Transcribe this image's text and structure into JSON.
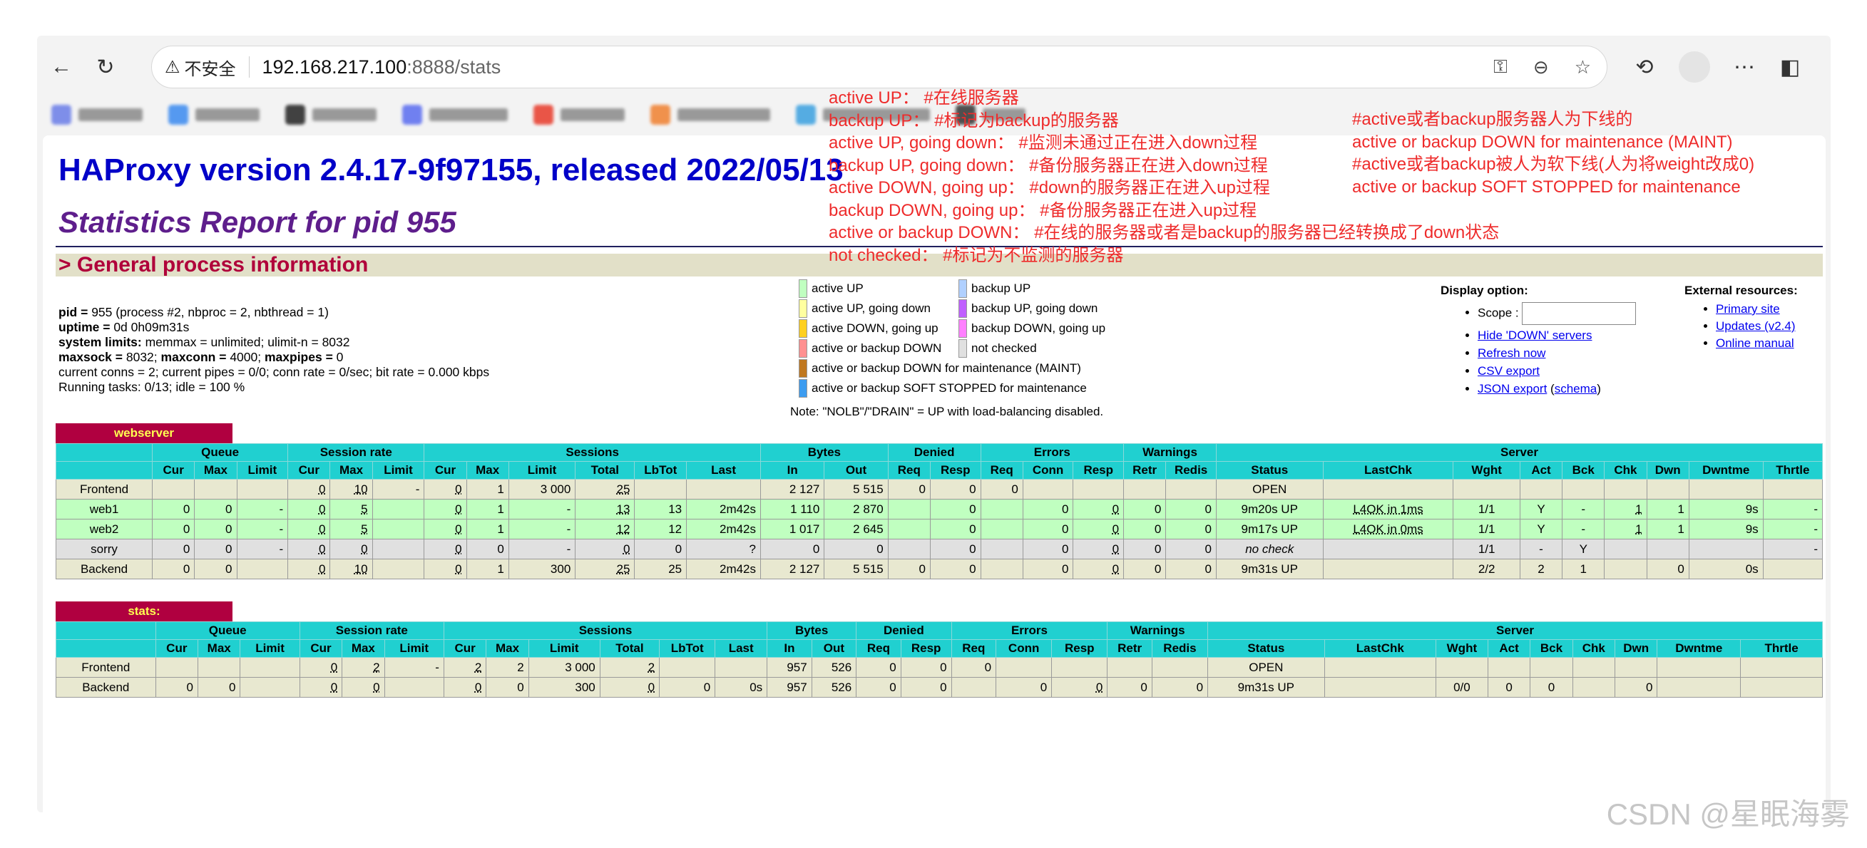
{
  "browser": {
    "security_label": "不安全",
    "url_host": "192.168.217.100",
    "url_path": ":8888/stats"
  },
  "page": {
    "title": "HAProxy version 2.4.17-9f97155, released 2022/05/13",
    "subtitle": "Statistics Report for pid 955",
    "section": "> General process information"
  },
  "process": {
    "pid_label": "pid =",
    "pid_value": " 955 (process #2, nbproc = 2, nbthread = 1)",
    "uptime_label": "uptime =",
    "uptime_value": " 0d 0h09m31s",
    "limits_label": "system limits:",
    "limits_value": " memmax = unlimited; ulimit-n = 8032",
    "maxsock_label": "maxsock =",
    "maxsock_value": " 8032; ",
    "maxconn_label": "maxconn =",
    "maxconn_value": " 4000; ",
    "maxpipes_label": "maxpipes =",
    "maxpipes_value": " 0",
    "conns": "current conns = 2; current pipes = 0/0; conn rate = 0/sec; bit rate = 0.000 kbps",
    "tasks": "Running tasks: 0/13; idle = 100 %"
  },
  "legend": {
    "items": [
      {
        "label": "active UP",
        "color": "#c0ffc0"
      },
      {
        "label": "active UP, going down",
        "color": "#ffffa0"
      },
      {
        "label": "active DOWN, going up",
        "color": "#ffd020"
      },
      {
        "label": "active or backup DOWN",
        "color": "#ff9090"
      },
      {
        "label": "active or backup DOWN for maintenance (MAINT)",
        "color": "#c07820"
      },
      {
        "label": "active or backup SOFT STOPPED for maintenance",
        "color": "#3c9cf0"
      },
      {
        "label": "backup UP",
        "color": "#b0d0ff"
      },
      {
        "label": "backup UP, going down",
        "color": "#c060ff"
      },
      {
        "label": "backup DOWN, going up",
        "color": "#ff80ff"
      },
      {
        "label": "not checked",
        "color": "#e0e0e0"
      }
    ],
    "note": "Note: \"NOLB\"/\"DRAIN\" = UP with load-balancing disabled."
  },
  "display_options": {
    "title": "Display option:",
    "scope_label": "Scope :",
    "links": [
      "Hide 'DOWN' servers",
      "Refresh now",
      "CSV export",
      "JSON export"
    ],
    "schema_link": "schema"
  },
  "external": {
    "title": "External resources:",
    "links": [
      "Primary site",
      "Updates (v2.4)",
      "Online manual"
    ]
  },
  "headers": {
    "queue": "Queue",
    "session_rate": "Session rate",
    "sessions": "Sessions",
    "bytes": "Bytes",
    "denied": "Denied",
    "errors": "Errors",
    "warnings": "Warnings",
    "server": "Server",
    "cur": "Cur",
    "max": "Max",
    "limit": "Limit",
    "total": "Total",
    "lbtot": "LbTot",
    "last": "Last",
    "in": "In",
    "out": "Out",
    "req": "Req",
    "resp": "Resp",
    "conn": "Conn",
    "retr": "Retr",
    "redis": "Redis",
    "status": "Status",
    "lastchk": "LastChk",
    "wght": "Wght",
    "act": "Act",
    "bck": "Bck",
    "chk": "Chk",
    "dwn": "Dwn",
    "dwntme": "Dwntme",
    "thrtle": "Thrtle"
  },
  "webserver": {
    "name": "webserver",
    "frontend": [
      "Frontend",
      "",
      "",
      "",
      "0",
      "10",
      "-",
      "0",
      "1",
      "3 000",
      "25",
      "",
      "",
      "2 127",
      "5 515",
      "0",
      "0",
      "0",
      "",
      "",
      "",
      "",
      "OPEN",
      "",
      "",
      "",
      "",
      "",
      "",
      "",
      ""
    ],
    "web1": [
      "web1",
      "0",
      "0",
      "-",
      "0",
      "5",
      "",
      "0",
      "1",
      "-",
      "13",
      "13",
      "2m42s",
      "1 110",
      "2 870",
      "",
      "0",
      "",
      "0",
      "0",
      "0",
      "0",
      "9m20s UP",
      "L4OK in 1ms",
      "1/1",
      "Y",
      "-",
      "1",
      "1",
      "9s",
      "-"
    ],
    "web2": [
      "web2",
      "0",
      "0",
      "-",
      "0",
      "5",
      "",
      "0",
      "1",
      "-",
      "12",
      "12",
      "2m42s",
      "1 017",
      "2 645",
      "",
      "0",
      "",
      "0",
      "0",
      "0",
      "0",
      "9m17s UP",
      "L4OK in 0ms",
      "1/1",
      "Y",
      "-",
      "1",
      "1",
      "9s",
      "-"
    ],
    "sorry": [
      "sorry",
      "0",
      "0",
      "-",
      "0",
      "0",
      "",
      "0",
      "0",
      "-",
      "0",
      "0",
      "?",
      "0",
      "0",
      "",
      "0",
      "",
      "0",
      "0",
      "0",
      "0",
      "no check",
      "",
      "1/1",
      "-",
      "Y",
      "",
      "",
      "",
      "-"
    ],
    "backend": [
      "Backend",
      "0",
      "0",
      "",
      "0",
      "10",
      "",
      "0",
      "1",
      "300",
      "25",
      "25",
      "2m42s",
      "2 127",
      "5 515",
      "0",
      "0",
      "",
      "0",
      "0",
      "0",
      "0",
      "9m31s UP",
      "",
      "2/2",
      "2",
      "1",
      "",
      "0",
      "0s",
      ""
    ]
  },
  "stats": {
    "name": "stats:",
    "frontend": [
      "Frontend",
      "",
      "",
      "",
      "0",
      "2",
      "-",
      "2",
      "2",
      "3 000",
      "2",
      "",
      "",
      "957",
      "526",
      "0",
      "0",
      "0",
      "",
      "",
      "",
      "",
      "OPEN",
      "",
      "",
      "",
      "",
      "",
      "",
      "",
      ""
    ],
    "backend": [
      "Backend",
      "0",
      "0",
      "",
      "0",
      "0",
      "",
      "0",
      "0",
      "300",
      "0",
      "0",
      "0s",
      "957",
      "526",
      "0",
      "0",
      "",
      "0",
      "0",
      "0",
      "0",
      "9m31s UP",
      "",
      "0/0",
      "0",
      "0",
      "",
      "0",
      "",
      ""
    ]
  },
  "annotations": {
    "left": [
      "active UP：      #在线服务器",
      "backup UP：   #标记为backup的服务器",
      "active UP, going down：  #监测未通过正在进入down过程",
      "backup UP, going down：  #备份服务器正在进入down过程",
      "active DOWN, going up：  #down的服务器正在进入up过程",
      "backup DOWN, going up：  #备份服务器正在进入up过程",
      "active or backup DOWN：  #在线的服务器或者是backup的服务器已经转换成了down状态",
      "not checked：  #标记为不监测的服务器"
    ],
    "right": [
      "#active或者backup服务器人为下线的",
      "active or backup DOWN for maintenance (MAINT)",
      "#active或者backup被人为软下线(人为将weight改成0)",
      "active or backup SOFT STOPPED for maintenance"
    ]
  },
  "watermark": "CSDN @星眠海雾"
}
